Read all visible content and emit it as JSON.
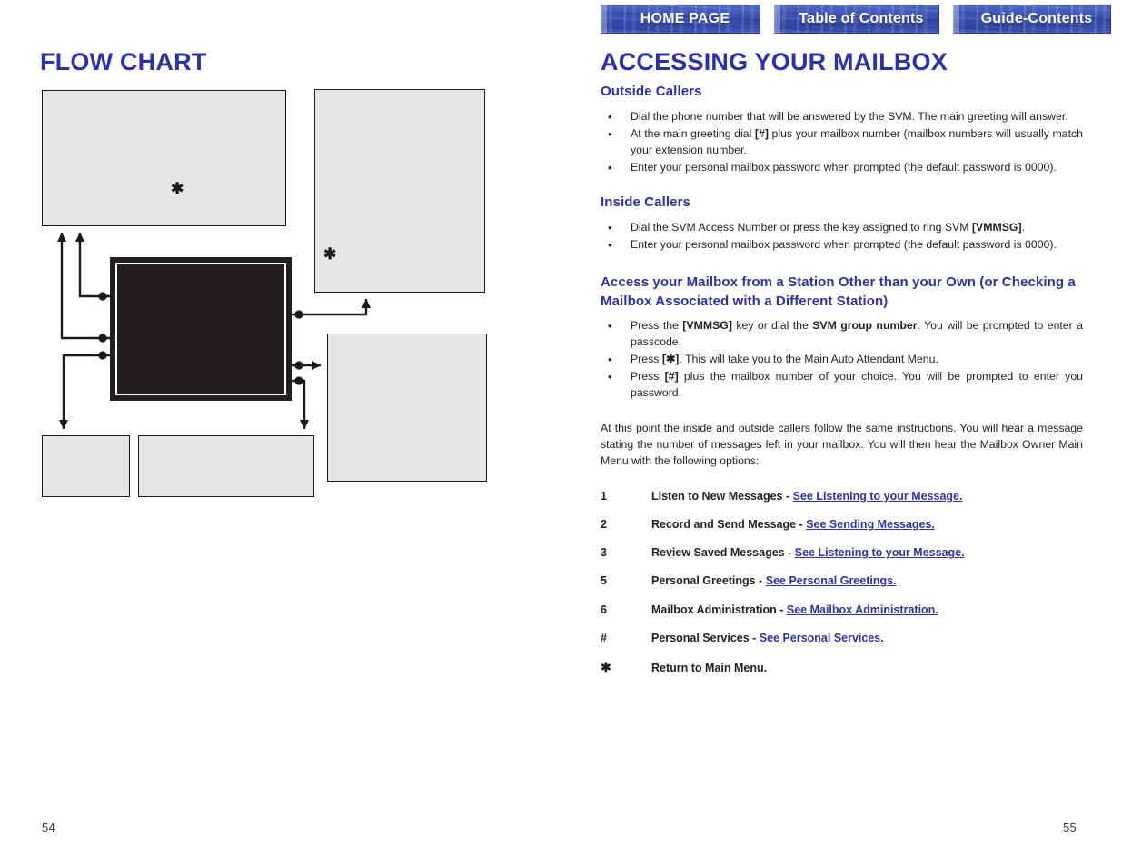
{
  "document": {
    "title": "SVM Voice Mail User Guide spread",
    "pages": {
      "left": "54",
      "right": "55"
    }
  },
  "nav": {
    "buttons": [
      {
        "name": "home-page",
        "label": "HOME PAGE"
      },
      {
        "name": "table-of-contents",
        "label": "Table of Contents"
      },
      {
        "name": "guide-contents",
        "label": "Guide-Contents"
      }
    ]
  },
  "left_page": {
    "title": "FLOW CHART",
    "page_number": "54",
    "boxes": [
      {
        "name": "top-left",
        "marker": "✱"
      },
      {
        "name": "top-right",
        "marker": "✱"
      },
      {
        "name": "mid-right",
        "marker": ""
      },
      {
        "name": "bottom-left",
        "marker": ""
      },
      {
        "name": "bottom-middle",
        "marker": ""
      },
      {
        "name": "center",
        "marker": ""
      }
    ]
  },
  "right_page": {
    "page_number": "55",
    "title": "ACCESSING YOUR MAILBOX",
    "sections": [
      {
        "heading": "Outside Callers",
        "bullets": [
          {
            "pre": "Dial the phone number that will be answered by the SVM. The main greeting will answer.",
            "bold": "",
            "post": ""
          },
          {
            "pre": "At the main greeting dial ",
            "bold": "[#]",
            "post": " plus your mailbox number (mailbox numbers will usually match your extension number."
          },
          {
            "pre": "Enter your personal mailbox password when prompted (the default password is 0000).",
            "bold": "",
            "post": ""
          }
        ]
      },
      {
        "heading": "Inside Callers",
        "bullets": [
          {
            "pre": "Dial the SVM Access Number or press the key assigned to ring SVM ",
            "bold": "[VMMSG]",
            "post": "."
          },
          {
            "pre": "Enter your personal mailbox password when prompted (the default password  is 0000).",
            "bold": "",
            "post": ""
          }
        ]
      },
      {
        "heading": "Access your Mailbox from a Station Other than your Own (or Checking a Mailbox Associated with a Different Station)",
        "bullets": [
          {
            "pre": "Press the ",
            "bold": "[VMMSG]",
            "post": " key or dial the ",
            "bold2": "SVM group number",
            "post2": ". You will be prompted to enter a passcode."
          },
          {
            "pre": "Press ",
            "bold": "[✱]",
            "post": ". This will take you to the Main Auto Attendant Menu."
          },
          {
            "pre": "Press ",
            "bold": "[#]",
            "post": " plus the mailbox number of your choice. You will be prompted to enter you password."
          }
        ]
      }
    ],
    "paragraph": "At this point the inside and outside callers follow the same instructions. You will hear a message stating the number of messages left in your mailbox. You will then hear the Mailbox Owner Main Menu with the following options:",
    "menu_options": [
      {
        "key": "1",
        "label": "Listen to New Messages - ",
        "link": "See Listening to your Message."
      },
      {
        "key": "2",
        "label": "Record and Send Message - ",
        "link": "See Sending Messages."
      },
      {
        "key": "3",
        "label": "Review Saved Messages - ",
        "link": "See Listening to your Message."
      },
      {
        "key": "5",
        "label": "Personal Greetings - ",
        "link": "See Personal Greetings."
      },
      {
        "key": "6",
        "label": "Mailbox Administration - ",
        "link": "See Mailbox Administration. "
      },
      {
        "key": "#",
        "label": "Personal Services - ",
        "link": "See Personal Services."
      },
      {
        "key": "✱",
        "label": "Return to Main Menu.",
        "link": ""
      }
    ]
  },
  "colors": {
    "heading_blue": "#2e31a3",
    "link_blue": "#2e31a3",
    "box_fill": "#e4e5e7",
    "box_stroke": "#1a1a1a",
    "center_box": "#231f20",
    "nav_blue": "#3b55b4"
  }
}
